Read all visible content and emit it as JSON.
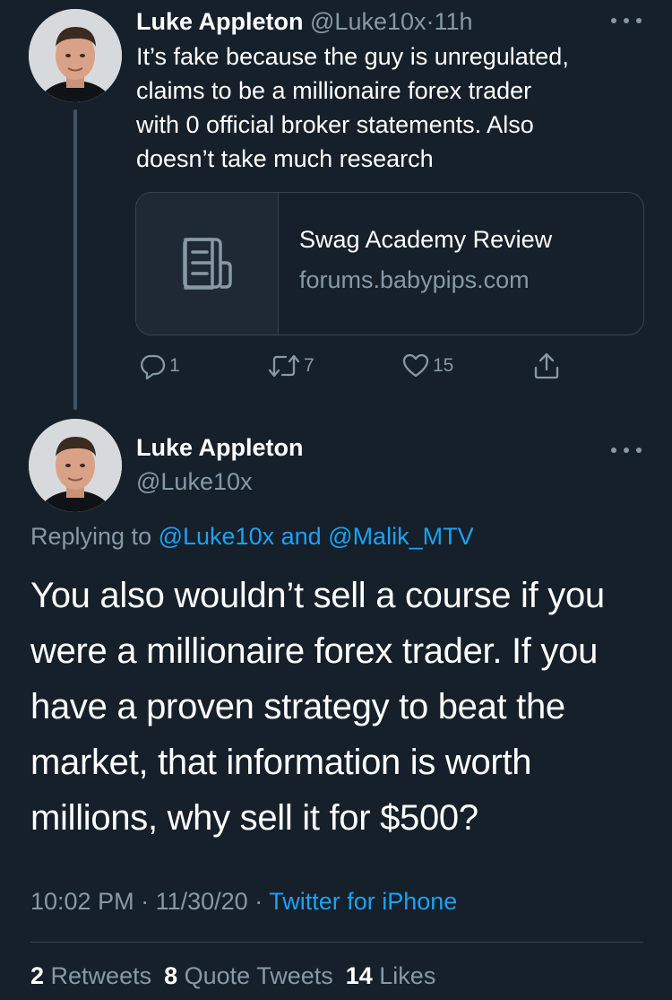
{
  "colors": {
    "background": "#15202b",
    "text": "#ffffff",
    "muted": "#8899a6",
    "link": "#1da1f2",
    "border": "#38444d"
  },
  "tweet1": {
    "name": "Luke Appleton",
    "handle": "@Luke10x",
    "separator": "·",
    "time": "11h",
    "text_lines": [
      "It’s fake because the guy is unregulated,",
      "claims to be a millionaire forex trader",
      "with 0 official broker statements. Also",
      "doesn’t take much research"
    ],
    "card": {
      "icon": "document-icon",
      "title": "Swag Academy Review",
      "domain": "forums.babypips.com"
    },
    "actions": {
      "replies": "1",
      "retweets": "7",
      "likes": "15"
    }
  },
  "tweet2": {
    "name": "Luke Appleton",
    "handle": "@Luke10x",
    "replying_prefix": "Replying to ",
    "replying_to_1": "@Luke10x",
    "replying_and": " and ",
    "replying_to_2": "@Malik_MTV",
    "text_lines": [
      "You also wouldn’t sell a course if you",
      "were a millionaire forex trader. If you",
      "have a proven strategy to beat the",
      "market, that information is worth",
      "millions, why sell it for $500?"
    ],
    "time": "10:02 PM",
    "sep1": " · ",
    "date": "11/30/20",
    "sep2": " · ",
    "source": "Twitter for iPhone",
    "stats": {
      "retweets_count": "2",
      "retweets_label": " Retweets",
      "quotes_count": "8",
      "quotes_label": " Quote Tweets",
      "likes_count": "14",
      "likes_label": " Likes"
    }
  }
}
